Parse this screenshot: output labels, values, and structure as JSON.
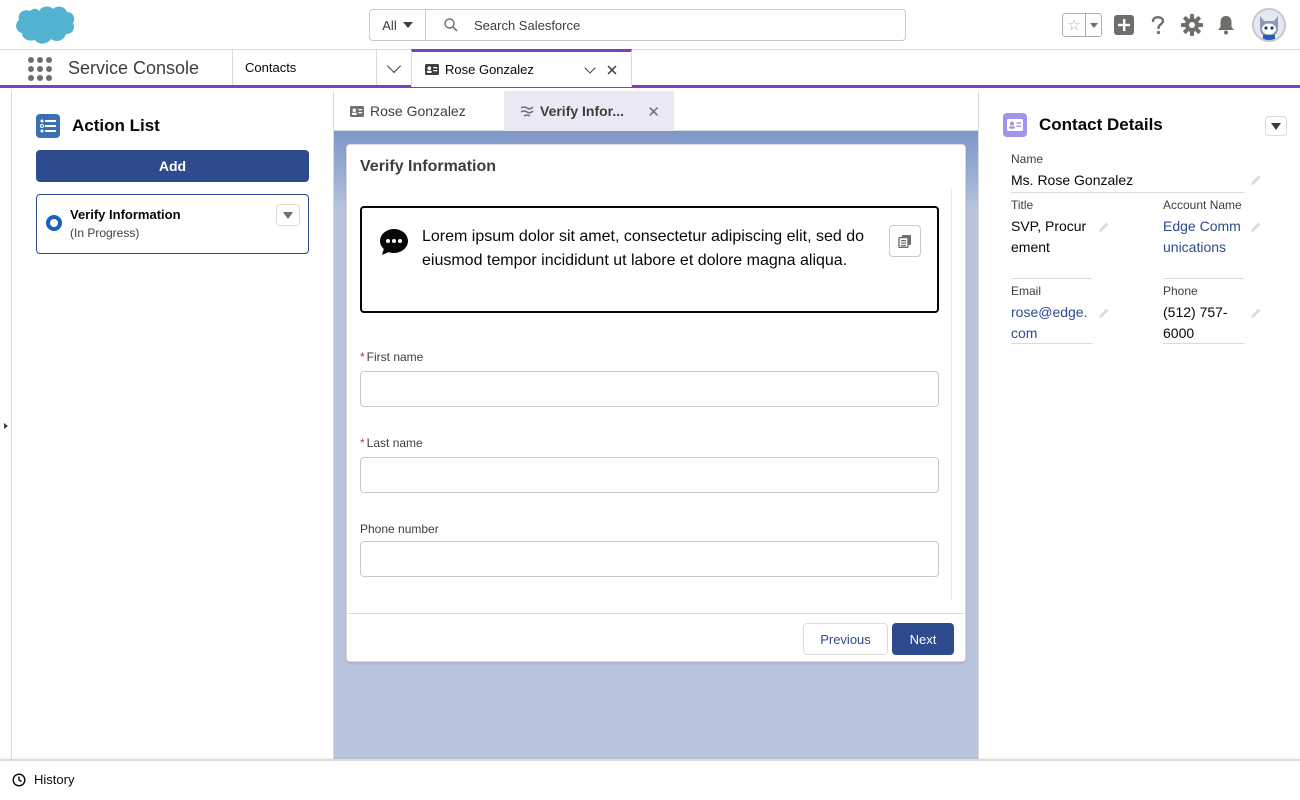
{
  "header": {
    "search_scope": "All",
    "search_placeholder": "Search Salesforce"
  },
  "nav": {
    "app_name": "Service Console",
    "tabs": [
      {
        "label": "Contacts"
      },
      {
        "label": "Rose Gonzalez"
      }
    ]
  },
  "action_list": {
    "title": "Action List",
    "add_label": "Add",
    "items": [
      {
        "title": "Verify Information",
        "status": "(In Progress)"
      }
    ]
  },
  "subtabs": [
    {
      "label": "Rose Gonzalez"
    },
    {
      "label": "Verify Infor..."
    }
  ],
  "flow": {
    "title": "Verify Information",
    "message": "Lorem ipsum dolor sit amet, consectetur adipiscing elit, sed do eiusmod tempor incididunt ut labore et dolore magna aliqua.",
    "required_marker": "*",
    "fields": [
      {
        "label": "First name",
        "required": true,
        "value": ""
      },
      {
        "label": "Last name",
        "required": true,
        "value": ""
      },
      {
        "label": "Phone number",
        "required": false,
        "value": ""
      }
    ],
    "previous_label": "Previous",
    "next_label": "Next"
  },
  "contact_details": {
    "title": "Contact Details",
    "name_label": "Name",
    "name_value": "Ms. Rose Gonzalez",
    "title_label": "Title",
    "title_value": "SVP, Procurement",
    "account_label": "Account Name",
    "account_value": "Edge Communications",
    "email_label": "Email",
    "email_value": "rose@edge.com",
    "phone_label": "Phone",
    "phone_value": "(512) 757-6000"
  },
  "utility": {
    "history_label": "History"
  },
  "colors": {
    "brand": "#2d4b8e",
    "console_accent": "#7f3fba",
    "salesforce_cloud": "#1798c1"
  },
  "icons": [
    "salesforce-logo",
    "search-icon",
    "star-icon",
    "plus-icon",
    "help-icon",
    "gear-icon",
    "bell-icon",
    "app-launcher-icon",
    "contact-card-icon",
    "action-list-icon",
    "chat-icon",
    "copy-icon",
    "pencil-icon",
    "history-icon"
  ]
}
